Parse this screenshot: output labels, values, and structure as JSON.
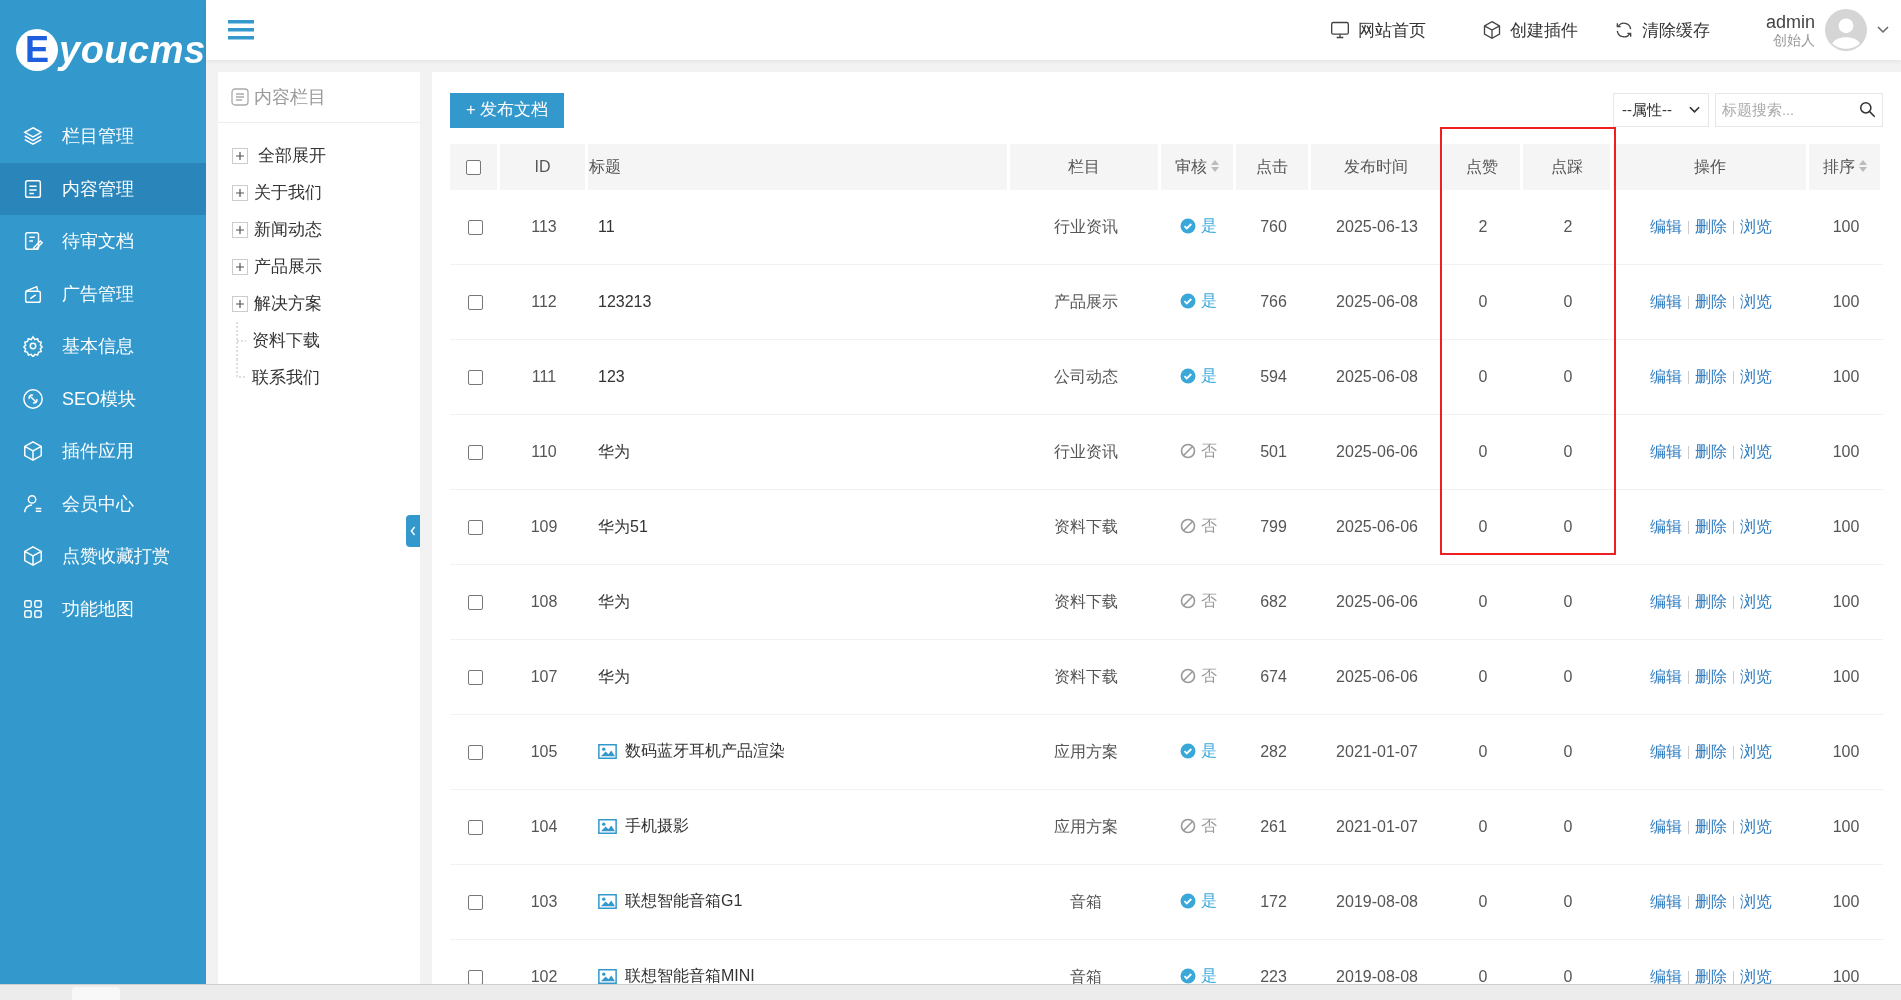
{
  "logo": {
    "letter": "E",
    "text": "youcms"
  },
  "sidebar": {
    "items": [
      {
        "label": "栏目管理",
        "selected": false
      },
      {
        "label": "内容管理",
        "selected": true
      },
      {
        "label": "待审文档",
        "selected": false
      },
      {
        "label": "广告管理",
        "selected": false
      },
      {
        "label": "基本信息",
        "selected": false
      },
      {
        "label": "SEO模块",
        "selected": false
      },
      {
        "label": "插件应用",
        "selected": false
      },
      {
        "label": "会员中心",
        "selected": false
      },
      {
        "label": "点赞收藏打赏",
        "selected": false
      },
      {
        "label": "功能地图",
        "selected": false
      }
    ]
  },
  "header": {
    "links": [
      {
        "label": "网站首页"
      },
      {
        "label": "创建插件"
      },
      {
        "label": "清除缓存"
      }
    ],
    "user": {
      "name": "admin",
      "role": "创始人"
    }
  },
  "tree": {
    "title": "内容栏目",
    "items": [
      {
        "label": "全部展开",
        "kind": "expand_all"
      },
      {
        "label": "关于我们",
        "kind": "branch"
      },
      {
        "label": "新闻动态",
        "kind": "branch"
      },
      {
        "label": "产品展示",
        "kind": "branch"
      },
      {
        "label": "解决方案",
        "kind": "branch"
      },
      {
        "label": "资料下载",
        "kind": "leaf"
      },
      {
        "label": "联系我们",
        "kind": "leaf"
      }
    ]
  },
  "annotation": {
    "kind": "frame"
  },
  "toolbar": {
    "add_button": "+ 发布文档",
    "filter": "--属性--",
    "search": {
      "placeholder": "标题搜索..."
    }
  },
  "table": {
    "header_checked": false,
    "columns": [
      {
        "label": "ID",
        "sortable": false
      },
      {
        "label": "标题",
        "sortable": false
      },
      {
        "label": "栏目",
        "sortable": false
      },
      {
        "label": "审核",
        "sortable": true
      },
      {
        "label": "点击",
        "sortable": false
      },
      {
        "label": "发布时间",
        "sortable": false
      },
      {
        "label": "点赞",
        "sortable": false
      },
      {
        "label": "点踩",
        "sortable": false
      },
      {
        "label": "操作",
        "sortable": false
      },
      {
        "label": "排序",
        "sortable": true
      }
    ],
    "rows": [
      {
        "checked": false,
        "id": "113",
        "title": "11",
        "thumbnail": false,
        "category": "行业资讯",
        "approved": true,
        "status": "是",
        "clicks": "760",
        "date": "2025-06-13",
        "likes": "2",
        "dislikes": "2",
        "actions": [
          "编辑",
          "删除",
          "浏览"
        ],
        "sort": "100"
      },
      {
        "checked": false,
        "id": "112",
        "title": "123213",
        "thumbnail": false,
        "category": "产品展示",
        "approved": true,
        "status": "是",
        "clicks": "766",
        "date": "2025-06-08",
        "likes": "0",
        "dislikes": "0",
        "actions": [
          "编辑",
          "删除",
          "浏览"
        ],
        "sort": "100"
      },
      {
        "checked": false,
        "id": "111",
        "title": "123",
        "thumbnail": false,
        "category": "公司动态",
        "approved": true,
        "status": "是",
        "clicks": "594",
        "date": "2025-06-08",
        "likes": "0",
        "dislikes": "0",
        "actions": [
          "编辑",
          "删除",
          "浏览"
        ],
        "sort": "100"
      },
      {
        "checked": false,
        "id": "110",
        "title": "华为",
        "thumbnail": false,
        "category": "行业资讯",
        "approved": false,
        "status": "否",
        "clicks": "501",
        "date": "2025-06-06",
        "likes": "0",
        "dislikes": "0",
        "actions": [
          "编辑",
          "删除",
          "浏览"
        ],
        "sort": "100"
      },
      {
        "checked": false,
        "id": "109",
        "title": "华为51",
        "thumbnail": false,
        "category": "资料下载",
        "approved": false,
        "status": "否",
        "clicks": "799",
        "date": "2025-06-06",
        "likes": "0",
        "dislikes": "0",
        "actions": [
          "编辑",
          "删除",
          "浏览"
        ],
        "sort": "100"
      },
      {
        "checked": false,
        "id": "108",
        "title": "华为",
        "thumbnail": false,
        "category": "资料下载",
        "approved": false,
        "status": "否",
        "clicks": "682",
        "date": "2025-06-06",
        "likes": "0",
        "dislikes": "0",
        "actions": [
          "编辑",
          "删除",
          "浏览"
        ],
        "sort": "100"
      },
      {
        "checked": false,
        "id": "107",
        "title": "华为",
        "thumbnail": false,
        "category": "资料下载",
        "approved": false,
        "status": "否",
        "clicks": "674",
        "date": "2025-06-06",
        "likes": "0",
        "dislikes": "0",
        "actions": [
          "编辑",
          "删除",
          "浏览"
        ],
        "sort": "100"
      },
      {
        "checked": false,
        "id": "105",
        "title": "数码蓝牙耳机产品渲染",
        "thumbnail": true,
        "category": "应用方案",
        "approved": true,
        "status": "是",
        "clicks": "282",
        "date": "2021-01-07",
        "likes": "0",
        "dislikes": "0",
        "actions": [
          "编辑",
          "删除",
          "浏览"
        ],
        "sort": "100"
      },
      {
        "checked": false,
        "id": "104",
        "title": "手机摄影",
        "thumbnail": true,
        "category": "应用方案",
        "approved": false,
        "status": "否",
        "clicks": "261",
        "date": "2021-01-07",
        "likes": "0",
        "dislikes": "0",
        "actions": [
          "编辑",
          "删除",
          "浏览"
        ],
        "sort": "100"
      },
      {
        "checked": false,
        "id": "103",
        "title": "联想智能音箱G1",
        "thumbnail": true,
        "category": "音箱",
        "approved": true,
        "status": "是",
        "clicks": "172",
        "date": "2019-08-08",
        "likes": "0",
        "dislikes": "0",
        "actions": [
          "编辑",
          "删除",
          "浏览"
        ],
        "sort": "100"
      },
      {
        "checked": false,
        "id": "102",
        "title": "联想智能音箱MINI",
        "thumbnail": true,
        "category": "音箱",
        "approved": true,
        "status": "是",
        "clicks": "223",
        "date": "2019-08-08",
        "likes": "0",
        "dislikes": "0",
        "actions": [
          "编辑",
          "删除",
          "浏览"
        ],
        "sort": "100"
      }
    ]
  }
}
